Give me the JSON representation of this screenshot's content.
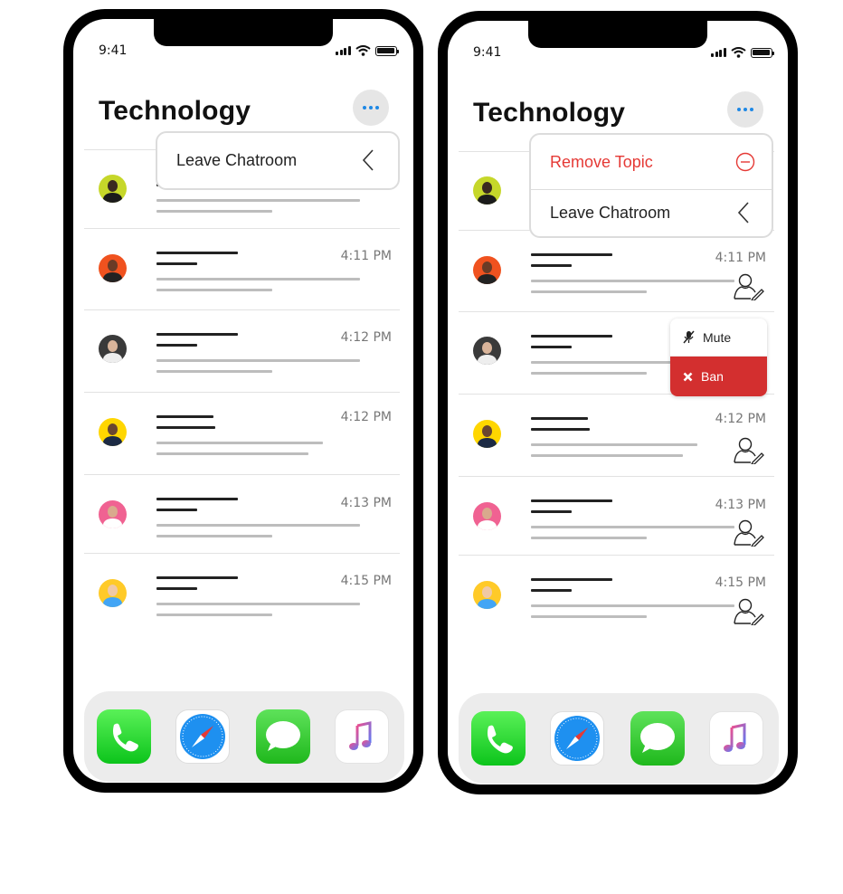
{
  "left_phone": {
    "status_time": "9:41",
    "title": "Technology",
    "popup": {
      "leave_label": "Leave Chatroom"
    },
    "rows": [
      {
        "time": ""
      },
      {
        "time": "4:11 PM"
      },
      {
        "time": "4:12 PM"
      },
      {
        "time": "4:12 PM"
      },
      {
        "time": "4:13 PM"
      },
      {
        "time": "4:15 PM"
      }
    ]
  },
  "right_phone": {
    "status_time": "9:41",
    "title": "Technology",
    "popup": {
      "remove_label": "Remove Topic",
      "leave_label": "Leave Chatroom"
    },
    "context_menu": {
      "mute_label": "Mute",
      "ban_label": "Ban"
    },
    "rows": [
      {
        "time": ""
      },
      {
        "time": "4:11 PM"
      },
      {
        "time": ""
      },
      {
        "time": "4:12 PM"
      },
      {
        "time": "4:13 PM"
      },
      {
        "time": "4:15 PM"
      }
    ]
  },
  "dock_apps": [
    "phone-icon",
    "safari-icon",
    "messages-icon",
    "music-icon"
  ],
  "colors": {
    "accent": "#1e88e5",
    "danger": "#d32f2f",
    "remove_text": "#e53935"
  }
}
